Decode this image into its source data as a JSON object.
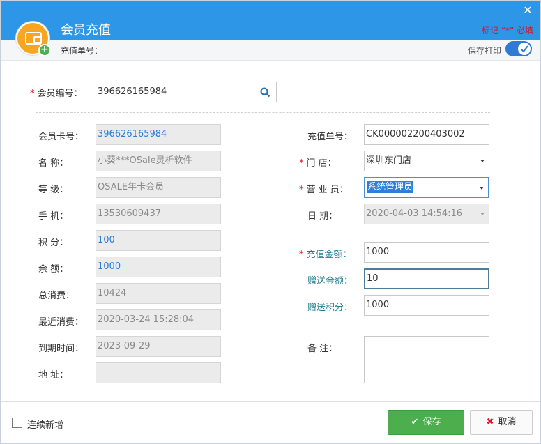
{
  "dialog": {
    "title": "会员充值",
    "required_note": "标记 “*” 必填",
    "order_no_label": "充值单号：",
    "print_label": "保存打印",
    "print_enabled": true
  },
  "member_search": {
    "label": "会员编号：",
    "value": "396626165984"
  },
  "left": {
    "card_no": {
      "label": "会员卡号：",
      "value": "396626165984"
    },
    "name": {
      "label": "名 称：",
      "value": "小葵***OSale灵析软件"
    },
    "level": {
      "label": "等 级：",
      "value": "OSALE年卡会员"
    },
    "phone": {
      "label": "手 机：",
      "value": "13530609437"
    },
    "points": {
      "label": "积 分：",
      "value": "100"
    },
    "balance": {
      "label": "余 额：",
      "value": "1000"
    },
    "total_spend": {
      "label": "总消费：",
      "value": "10424"
    },
    "last_spend": {
      "label": "最近消费：",
      "value": "2020-03-24 15:28:04"
    },
    "expire": {
      "label": "到期时间：",
      "value": "2023-09-29"
    },
    "address": {
      "label": "地 址：",
      "value": ""
    }
  },
  "right": {
    "order_no": {
      "label": "充值单号：",
      "value": "CK000002200403002"
    },
    "store": {
      "label": "门 店：",
      "value": "深圳东门店"
    },
    "salesperson": {
      "label": "营 业 员：",
      "value": "系统管理员"
    },
    "date": {
      "label": "日 期：",
      "value": "2020-04-03 14:54:16"
    },
    "amount": {
      "label": "充值金额：",
      "value": "1000"
    },
    "bonus_amount": {
      "label": "赠送金额：",
      "value": "10"
    },
    "bonus_points": {
      "label": "赠送积分：",
      "value": "1000"
    },
    "remark": {
      "label": "备 注：",
      "value": ""
    }
  },
  "footer": {
    "continuous_label": "连续新增",
    "save_label": "保存",
    "cancel_label": "取消"
  }
}
